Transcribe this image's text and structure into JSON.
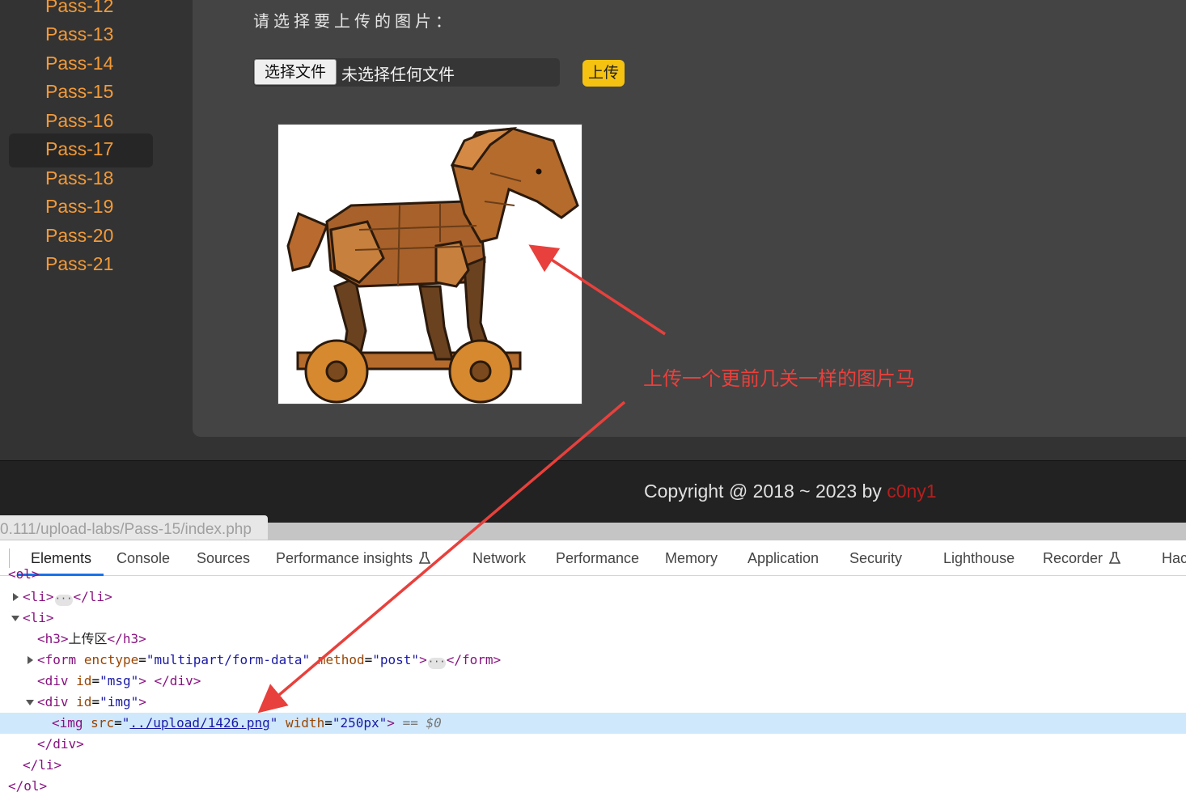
{
  "sidebar": {
    "items": [
      {
        "label": "Pass-12"
      },
      {
        "label": "Pass-13"
      },
      {
        "label": "Pass-14"
      },
      {
        "label": "Pass-15"
      },
      {
        "label": "Pass-16"
      },
      {
        "label": "Pass-17",
        "active": true
      },
      {
        "label": "Pass-18"
      },
      {
        "label": "Pass-19"
      },
      {
        "label": "Pass-20"
      },
      {
        "label": "Pass-21"
      }
    ]
  },
  "upload": {
    "prompt": "请选择要上传的图片：",
    "choose_button": "选择文件",
    "file_status": "未选择任何文件",
    "submit_button": "上传"
  },
  "annotation": {
    "text": "上传一个更前几关一样的图片马",
    "color": "#e8403c"
  },
  "footer": {
    "copyright": "Copyright @ 2018 ~ 2023 by ",
    "author": "c0ny1"
  },
  "status_url": "0.111/upload-labs/Pass-15/index.php",
  "devtools": {
    "tabs": [
      {
        "label": "Elements",
        "active": true
      },
      {
        "label": "Console"
      },
      {
        "label": "Sources"
      },
      {
        "label": "Performance insights",
        "icon": "flask-icon"
      },
      {
        "label": "Network"
      },
      {
        "label": "Performance"
      },
      {
        "label": "Memory"
      },
      {
        "label": "Application"
      },
      {
        "label": "Security"
      },
      {
        "label": "Lighthouse"
      },
      {
        "label": "Recorder",
        "icon": "flask-icon"
      },
      {
        "label": "Hac"
      }
    ],
    "dom": {
      "ol_open": "<ol>",
      "li_open": "<li>",
      "li_close": "</li>",
      "h3_open": "<h3>",
      "h3_text": "上传区",
      "h3_close": "</h3>",
      "form_open": "<form",
      "form_attr1": "enctype",
      "form_val1": "\"multipart/form-data\"",
      "form_attr2": "method",
      "form_val2": "\"post\"",
      "form_close": "</form>",
      "div_msg_open": "<div",
      "div_attr": "id",
      "div_msg_val": "\"msg\"",
      "div_close": "</div>",
      "div_img_val": "\"img\"",
      "img_open": "<img",
      "img_attr_src": "src",
      "img_src": "../upload/1426.png",
      "img_attr_width": "width",
      "img_width": "\"250px\"",
      "selected_marker": "== $0",
      "ol_close": "</ol>"
    }
  }
}
